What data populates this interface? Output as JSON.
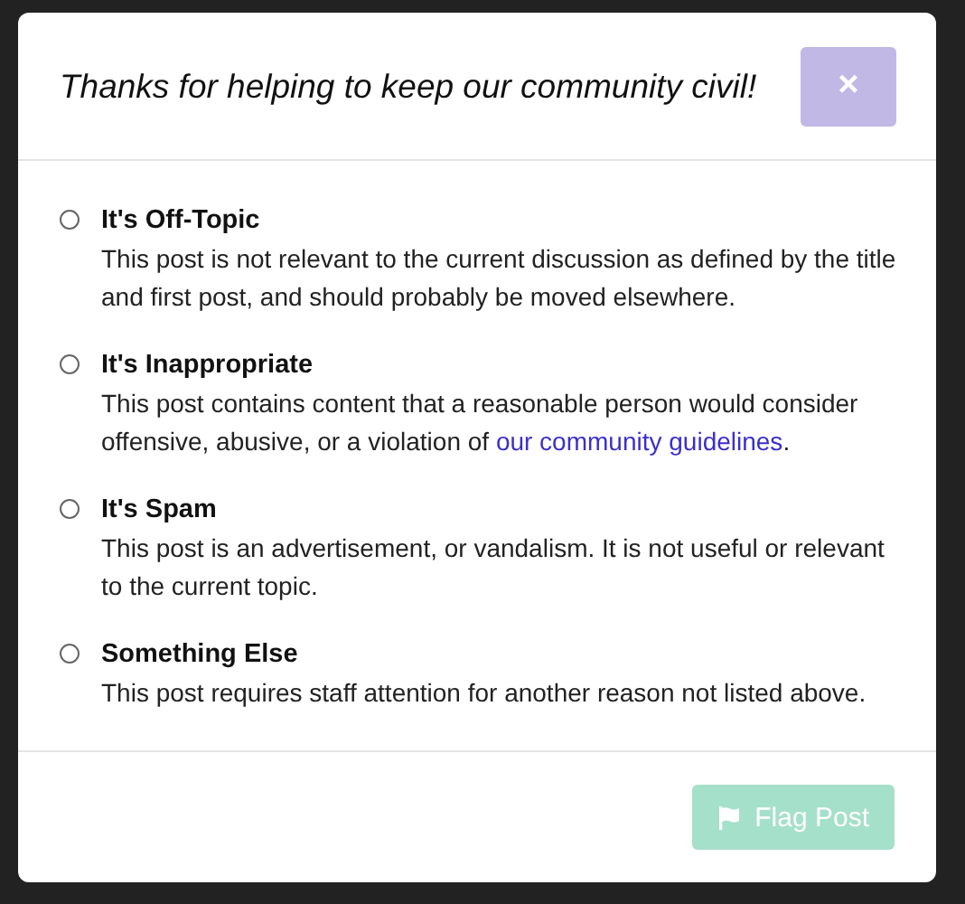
{
  "modal": {
    "title": "Thanks for helping to keep our community civil!",
    "close": "×"
  },
  "options": [
    {
      "label": "It's Off-Topic",
      "description": "This post is not relevant to the current discussion as defined by the title and first post, and should probably be moved elsewhere.",
      "selected": false
    },
    {
      "label": "It's Inappropriate",
      "description": "This post contains content that a reasonable person would consider offensive, abusive, or a violation of ",
      "link": "our community guidelines",
      "after": ".",
      "selected": false
    },
    {
      "label": "It's Spam",
      "description": "This post is an advertisement, or vandalism. It is not useful or relevant to the current topic.",
      "selected": false
    },
    {
      "label": "Something Else",
      "description": "This post requires staff attention for another reason not listed above.",
      "selected": false
    }
  ],
  "submit": {
    "label": "Flag Post",
    "disabled": true
  }
}
